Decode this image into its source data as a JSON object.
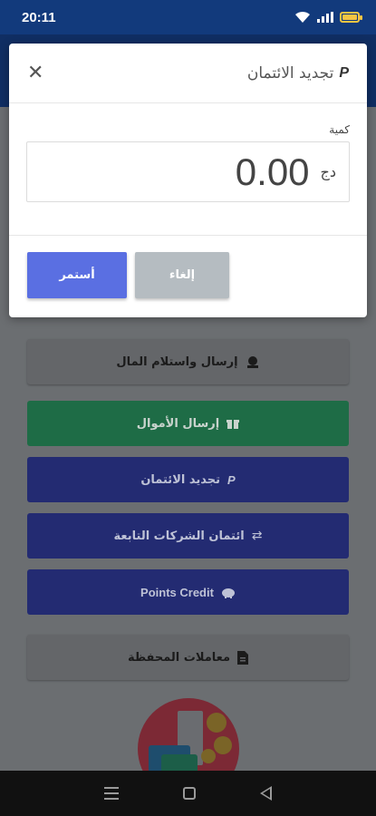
{
  "status_bar": {
    "time": "20:11",
    "icons": [
      "wifi-icon",
      "signal-icon",
      "battery-icon"
    ]
  },
  "modal": {
    "title": "تجديد الائتمان",
    "title_icon": "paypal-icon",
    "close_symbol": "✕",
    "amount_label": "كمية",
    "amount_value": "0.00",
    "currency": "دج",
    "continue_label": "أستمر",
    "cancel_label": "إلغاء",
    "colors": {
      "continue": "#5a6fe2",
      "cancel": "#b5bcc1"
    }
  },
  "actions": [
    {
      "label": "إرسال واستلام المال",
      "icon": "money-transfer-icon",
      "style": "light"
    },
    {
      "label": "إرسال الأموال",
      "icon": "gift-icon",
      "style": "green"
    },
    {
      "label": "تجديد الائتمان",
      "icon": "paypal-icon",
      "style": "blue"
    },
    {
      "label": "ائتمان الشركات التابعة",
      "icon": "exchange-arrows-icon",
      "style": "blue"
    },
    {
      "label": "Points Credit",
      "icon": "piggy-bank-icon",
      "style": "blue"
    },
    {
      "label": "معاملات المحفظة",
      "icon": "document-icon",
      "style": "light"
    }
  ],
  "colors": {
    "overlay_bg": "#6b6e71",
    "header": "#102e63",
    "status": "#123a7c",
    "green": "#1e6c46",
    "blue": "#232b72"
  },
  "nav_bar": {
    "icons": [
      "menu-icon",
      "home-icon",
      "back-icon"
    ]
  }
}
